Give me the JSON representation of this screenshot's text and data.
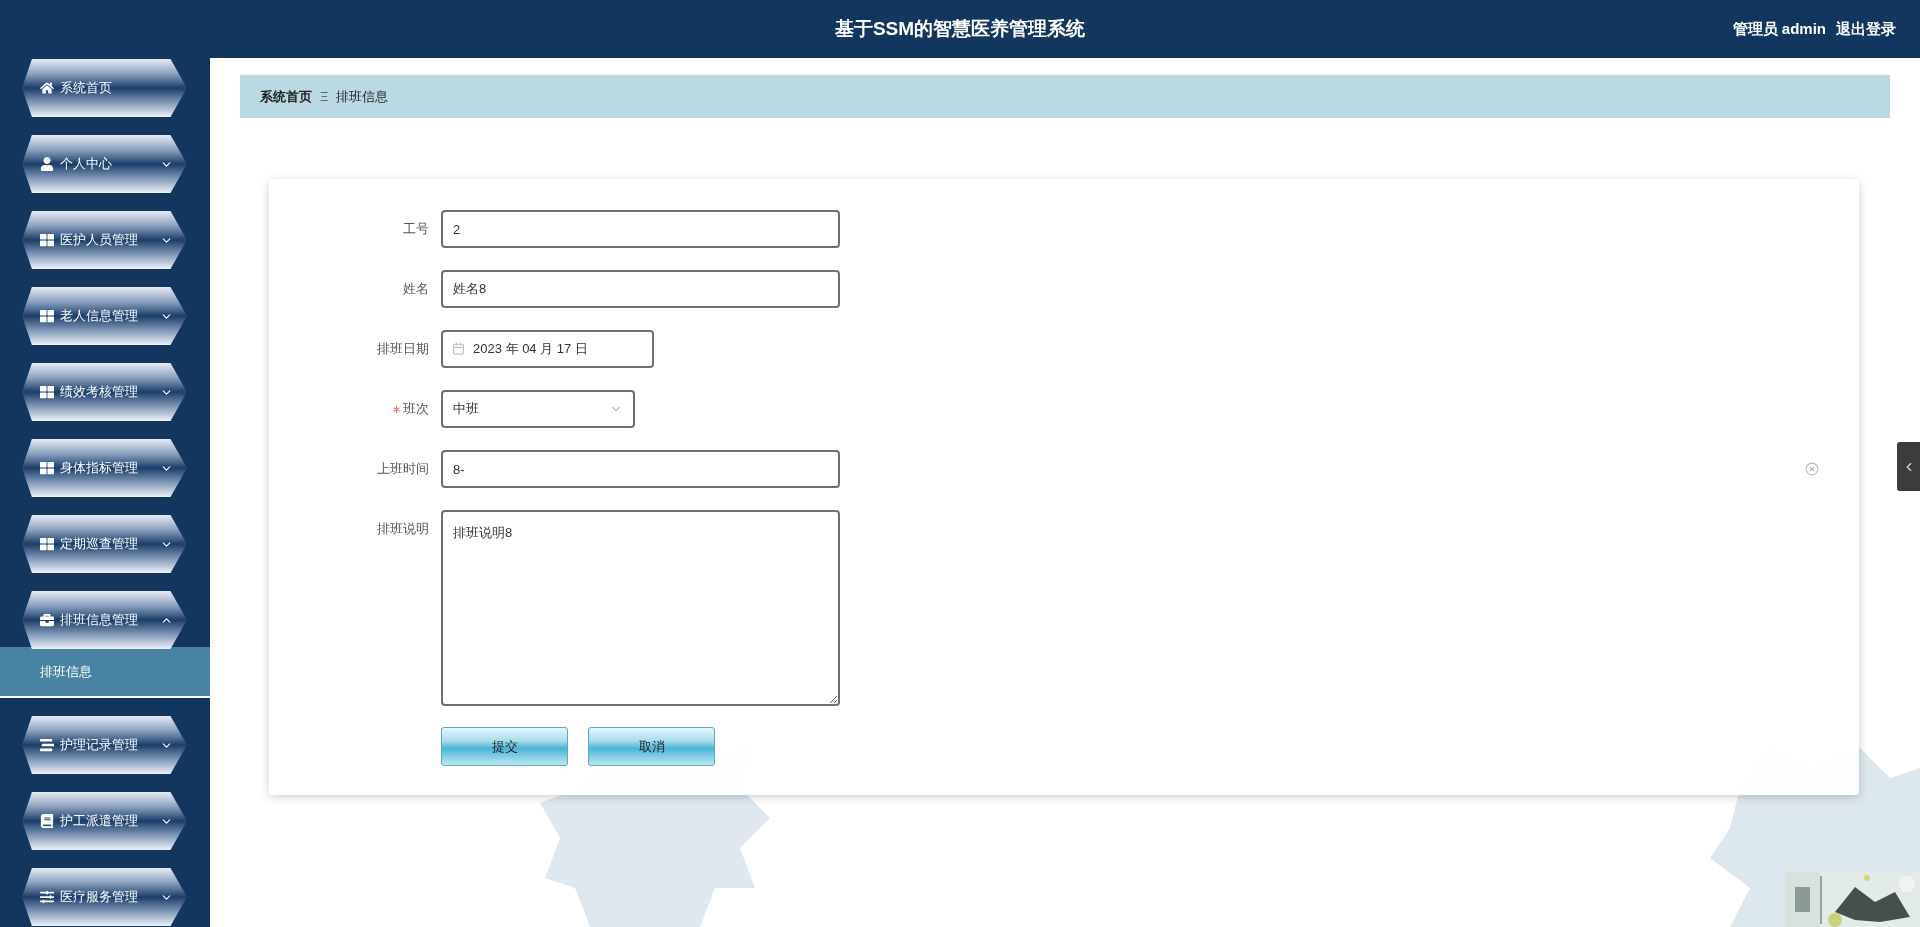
{
  "header": {
    "title": "基于SSM的智慧医养管理系统",
    "user": "管理员 admin",
    "logout": "退出登录"
  },
  "sidebar": {
    "items": [
      {
        "label": "系统首页",
        "kind": "link"
      },
      {
        "label": "个人中心",
        "kind": "menu",
        "expanded": false
      },
      {
        "label": "医护人员管理",
        "kind": "menu",
        "expanded": false
      },
      {
        "label": "老人信息管理",
        "kind": "menu",
        "expanded": false
      },
      {
        "label": "绩效考核管理",
        "kind": "menu",
        "expanded": false
      },
      {
        "label": "身体指标管理",
        "kind": "menu",
        "expanded": false
      },
      {
        "label": "定期巡查管理",
        "kind": "menu",
        "expanded": false
      },
      {
        "label": "排班信息管理",
        "kind": "menu",
        "expanded": true,
        "children": [
          {
            "label": "排班信息",
            "selected": true
          }
        ]
      },
      {
        "label": "护理记录管理",
        "kind": "menu",
        "expanded": false
      },
      {
        "label": "护工派遣管理",
        "kind": "menu",
        "expanded": false
      },
      {
        "label": "医疗服务管理",
        "kind": "menu",
        "expanded": false
      }
    ]
  },
  "breadcrumb": {
    "items": [
      "系统首页",
      "排班信息"
    ],
    "separator": "Ξ"
  },
  "form": {
    "fields": [
      {
        "label": "工号",
        "kind": "text",
        "value": "2",
        "required": false,
        "clearable": false
      },
      {
        "label": "姓名",
        "kind": "text",
        "value": "姓名8",
        "required": false,
        "clearable": false
      },
      {
        "label": "排班日期",
        "kind": "date",
        "value": "2023 年 04 月 17 日",
        "required": false,
        "clearable": false
      },
      {
        "label": "班次",
        "kind": "select",
        "value": "中班",
        "required": true,
        "clearable": false
      },
      {
        "label": "上班时间",
        "kind": "text",
        "value": "8-",
        "required": false,
        "clearable": true
      },
      {
        "label": "排班说明",
        "kind": "textarea",
        "value": "排班说明8",
        "required": false,
        "clearable": false
      }
    ],
    "buttons": [
      "提交",
      "取消"
    ]
  }
}
